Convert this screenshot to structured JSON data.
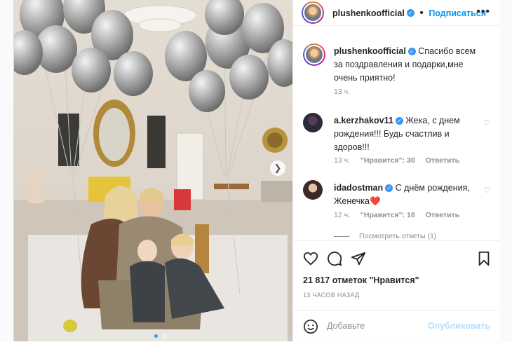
{
  "header": {
    "username": "plushenkoofficial",
    "follow_label": "Подписаться",
    "more_icon": "•••"
  },
  "caption": {
    "username": "plushenkoofficial",
    "text": "Спасибо всем за поздравления и подарки,мне очень приятно!",
    "time": "13 ч."
  },
  "comments": [
    {
      "username": "a.kerzhakov11",
      "text": "Жека, с днем рождения!!! Будь счастлив и здоров!!!",
      "time": "13 ч.",
      "likes": "\"Нравится\": 30",
      "reply": "Ответить"
    },
    {
      "username": "idadostman",
      "text": "С днём рождения, Женечка",
      "emoji": "❤️",
      "time": "12 ч.",
      "likes": "\"Нравится\": 16",
      "reply": "Ответить"
    }
  ],
  "view_replies": "Посмотреть ответы (1)",
  "likes_text": "21 817 отметок \"Нравится\"",
  "timestamp": "13 ЧАСОВ НАЗАД",
  "add_comment": {
    "placeholder": "Добавьте",
    "post_label": "Опубликовать"
  },
  "colors": {
    "link": "#0095f6",
    "verified": "#3897f0",
    "muted": "#8e8e8e"
  },
  "carousel": {
    "slide_count": 2,
    "active_index": 0
  }
}
